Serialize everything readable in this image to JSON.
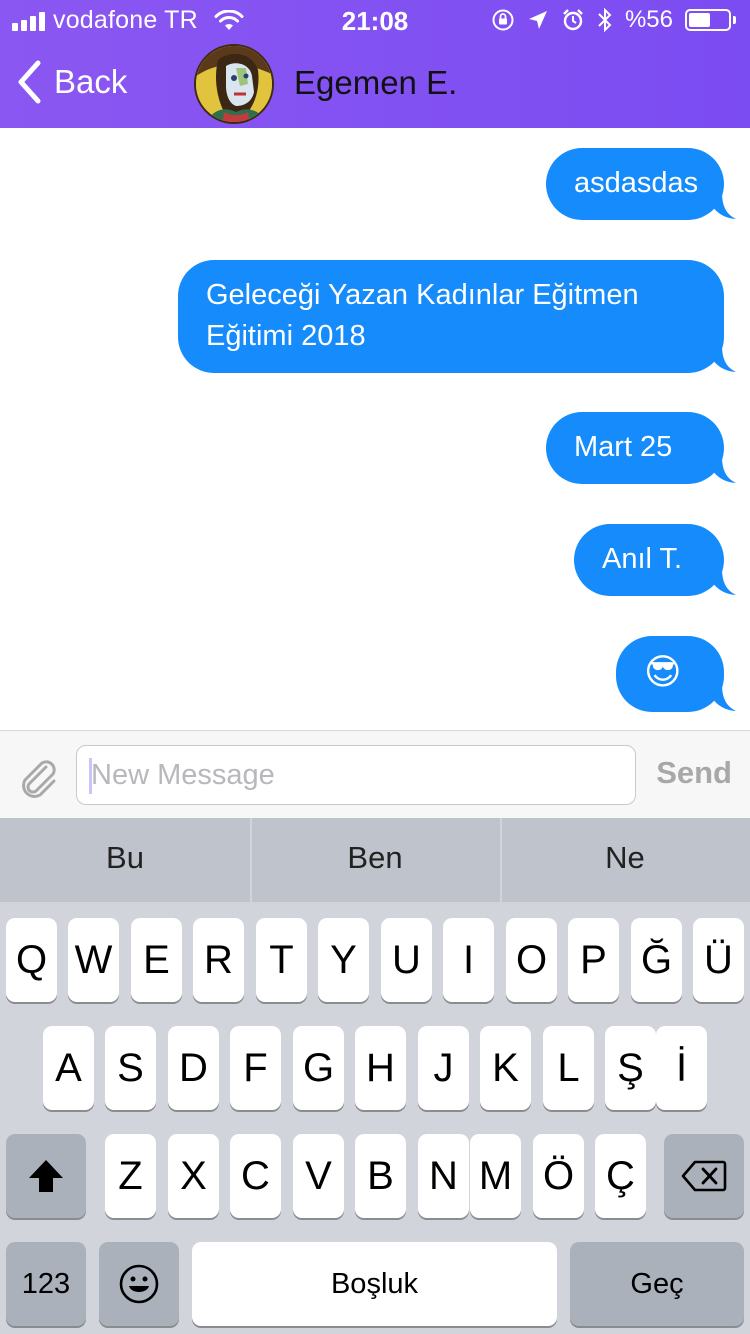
{
  "status_bar": {
    "carrier": "vodafone TR",
    "time": "21:08",
    "battery_text": "%56",
    "battery_level": 0.56
  },
  "nav": {
    "back_label": "Back",
    "contact_name": "Egemen E."
  },
  "messages": [
    {
      "text": "asdasdas",
      "from": "me"
    },
    {
      "text": "Geleceği Yazan Kadınlar Eğitmen Eğitimi 2018",
      "from": "me"
    },
    {
      "text": "Mart 25",
      "from": "me"
    },
    {
      "text": "Anıl T.",
      "from": "me"
    },
    {
      "text": "😎",
      "from": "me"
    }
  ],
  "input": {
    "placeholder": "New Message",
    "value": "",
    "send_label": "Send"
  },
  "keyboard": {
    "suggestions": [
      "Bu",
      "Ben",
      "Ne"
    ],
    "row1": [
      "Q",
      "W",
      "E",
      "R",
      "T",
      "Y",
      "U",
      "I",
      "O",
      "P",
      "Ğ",
      "Ü"
    ],
    "row2": [
      "A",
      "S",
      "D",
      "F",
      "G",
      "H",
      "J",
      "K",
      "L",
      "Ş",
      "İ"
    ],
    "row3": [
      "Z",
      "X",
      "C",
      "V",
      "B",
      "N",
      "M",
      "Ö",
      "Ç"
    ],
    "numbers_label": "123",
    "space_label": "Boşluk",
    "return_label": "Geç"
  },
  "colors": {
    "header": "#8b57f2",
    "bubble": "#168bfb",
    "keyboard_bg": "#d1d4da"
  },
  "icons": [
    "wifi-icon",
    "orientation-lock-icon",
    "location-icon",
    "alarm-icon",
    "bluetooth-icon",
    "battery-icon",
    "back-chevron-icon",
    "paperclip-icon",
    "shift-icon",
    "backspace-icon",
    "emoji-icon"
  ]
}
